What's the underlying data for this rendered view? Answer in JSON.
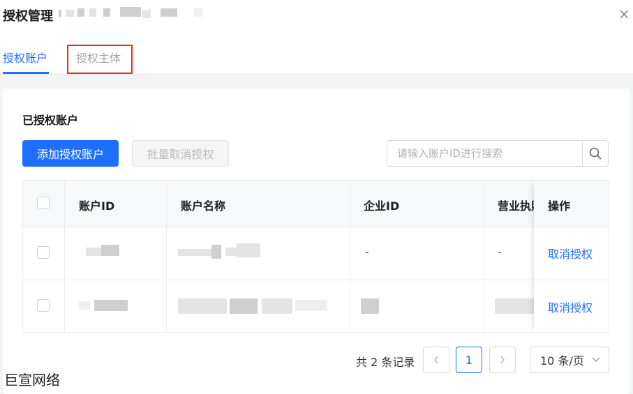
{
  "dialog": {
    "title": "授权管理",
    "close_glyph": "×"
  },
  "tabs": [
    {
      "label": "授权账户",
      "active": true
    },
    {
      "label": "授权主体",
      "active": false
    }
  ],
  "section": {
    "title": "已授权账户",
    "add_button": "添加授权账户",
    "batch_cancel_button": "批量取消授权",
    "search_placeholder": "请输入账户ID进行搜索"
  },
  "table": {
    "columns": [
      "账户ID",
      "账户名称",
      "企业ID",
      "营业执照",
      "操作"
    ],
    "rows": [
      {
        "enterprise_id": "-",
        "license": "-",
        "action": "取消授权"
      },
      {
        "enterprise_id": "",
        "license": "",
        "action": "取消授权"
      }
    ]
  },
  "pagination": {
    "total_text": "共 2 条记录",
    "prev_glyph": "<",
    "current_page": "1",
    "next_glyph": ">",
    "page_size": "10 条/页"
  },
  "watermark": "巨宣网络",
  "colors": {
    "primary": "#1f6fff",
    "highlight_border": "#e62e1f"
  }
}
